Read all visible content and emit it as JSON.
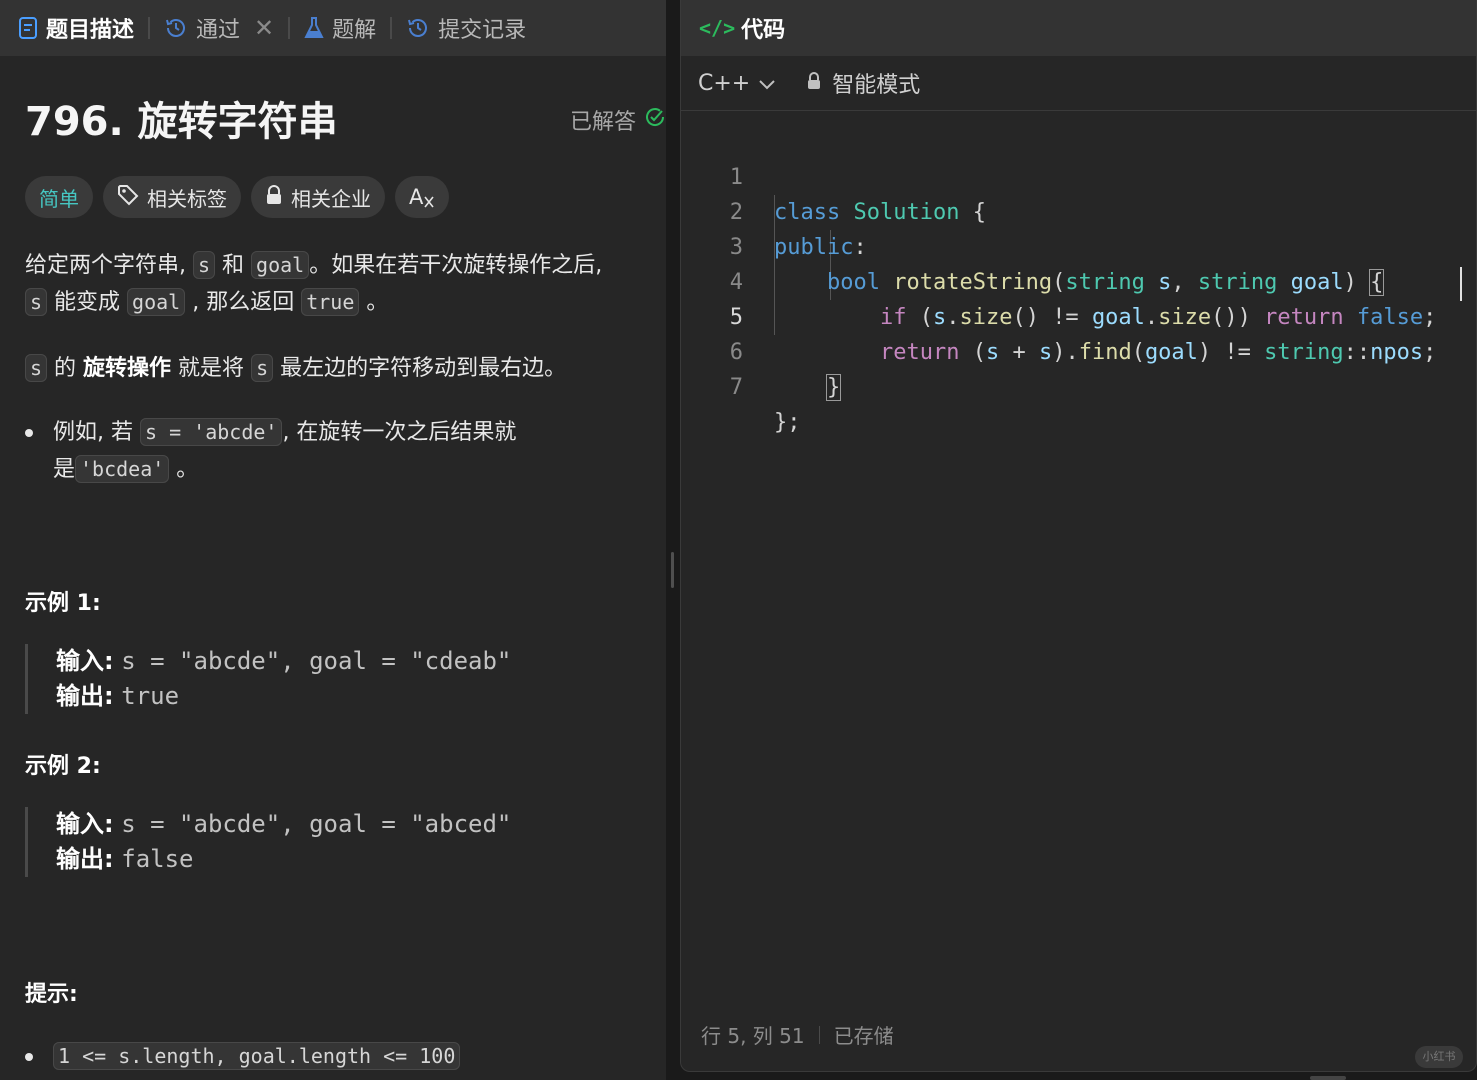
{
  "left_tabs": [
    {
      "label": "题目描述",
      "icon": "description-icon"
    },
    {
      "label": "通过",
      "icon": "history-icon"
    },
    {
      "label": "题解",
      "icon": "flask-icon"
    },
    {
      "label": "提交记录",
      "icon": "history-icon"
    }
  ],
  "tab_close": "✕",
  "problem": {
    "title": "796. 旋转字符串",
    "status": "已解答",
    "tags": {
      "difficulty": "简单",
      "related_tags": "相关标签",
      "related_companies": "相关企业",
      "font_size": "A"
    },
    "desc": {
      "p1_a": "给定两个字符串, ",
      "p1_s": "s",
      "p1_b": " 和 ",
      "p1_goal": "goal",
      "p1_c": "。如果在若干次旋转操作之后,",
      "p1_s2": "s",
      "p1_d": " 能变成 ",
      "p1_goal2": "goal",
      "p1_e": " , 那么返回 ",
      "p1_true": "true",
      "p1_f": " 。",
      "p2_s": "s",
      "p2_a": " 的 ",
      "p2_bold": "旋转操作",
      "p2_b": " 就是将 ",
      "p2_s2": "s",
      "p2_c": " 最左边的字符移动到最右边。",
      "bullet_a": "例如, 若 ",
      "bullet_code": "s = 'abcde'",
      "bullet_b": ", 在旋转一次之后结果就",
      "bullet_c": "是",
      "bullet_code2": "'bcdea'",
      "bullet_d": " 。"
    },
    "examples": [
      {
        "title": "示例 1:",
        "input_label": "输入:",
        "input": "s = \"abcde\", goal = \"cdeab\"",
        "output_label": "输出:",
        "output": "true"
      },
      {
        "title": "示例 2:",
        "input_label": "输入:",
        "input": "s = \"abcde\", goal = \"abced\"",
        "output_label": "输出:",
        "output": "false"
      }
    ],
    "hints_title": "提示:",
    "hint": "1 <= s.length, goal.length <= 100"
  },
  "code_panel": {
    "title": "代码",
    "icon": "</>",
    "language": "C++",
    "mode": "智能模式",
    "line_numbers": [
      "1",
      "2",
      "3",
      "4",
      "5",
      "6",
      "7"
    ],
    "status_position": "行 5, 列 51",
    "status_saved": "已存储"
  },
  "watermark": "小红书",
  "colors": {
    "accent_green": "#2cbb5d",
    "easy": "#46c6c2",
    "keyword": "#569cd6",
    "type": "#4ec9b0",
    "function": "#dcdcaa",
    "variable": "#9cdcfe",
    "control": "#c586c0"
  }
}
